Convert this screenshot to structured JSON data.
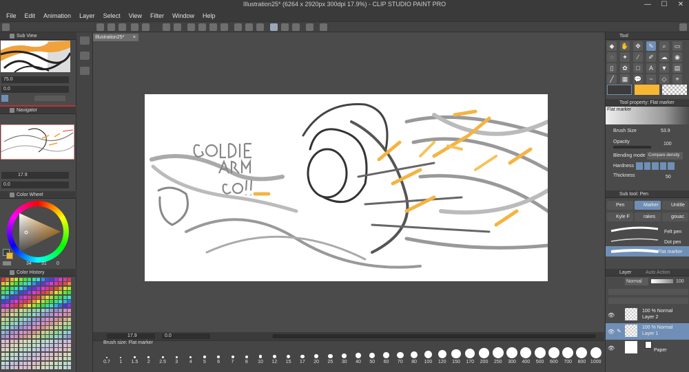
{
  "window": {
    "title": "Illustration25* (6264 x 2920px 300dpi 17.9%) - CLIP STUDIO PAINT PRO",
    "minimize": "—",
    "maximize": "☐",
    "close": "✕"
  },
  "menu": [
    "File",
    "Edit",
    "Animation",
    "Layer",
    "Select",
    "View",
    "Filter",
    "Window",
    "Help"
  ],
  "document_tab": {
    "label": "Illustration25*",
    "close": "×"
  },
  "sub_view": {
    "title": "Sub View",
    "zoom": "75.0",
    "angle": "0.0"
  },
  "navigator": {
    "title": "Navigator",
    "zoom": "17.9",
    "angle": "0.0"
  },
  "color_wheel": {
    "title": "Color Wheel",
    "h": "34",
    "s": "31",
    "v": "0",
    "accent": "#f0a030"
  },
  "color_history": {
    "title": "Color History"
  },
  "canvas_status": {
    "zoom": "17.9",
    "angle": "0.0"
  },
  "brush_size_bar": {
    "title": "Brush size: Flat marker",
    "sizes": [
      "0.7",
      "1",
      "1.5",
      "2",
      "2.5",
      "3",
      "4",
      "5",
      "6",
      "7",
      "8",
      "10",
      "12",
      "15",
      "17",
      "20",
      "25",
      "30",
      "40",
      "50",
      "60",
      "70",
      "80",
      "100",
      "120",
      "150",
      "170",
      "200",
      "250",
      "300",
      "400",
      "500",
      "600",
      "700",
      "800",
      "1000"
    ]
  },
  "tool_panel": {
    "title": "Tool"
  },
  "tool_property": {
    "title": "Tool property: Flat marker",
    "tool_name": "Flat marker",
    "brush_size_label": "Brush Size",
    "brush_size_value": "53.9",
    "opacity_label": "Opacity",
    "opacity_value": "100",
    "blending_label": "Blending mode",
    "blending_value": "Compare density",
    "hardness_label": "Hardness",
    "thickness_label": "Thickness",
    "thickness_value": "50"
  },
  "sub_tool": {
    "title": "Sub tool: Pen",
    "tabs": [
      "Pen",
      "Marker",
      "Untitle",
      "Kyle F",
      "rakes",
      "gouac"
    ],
    "strokes": [
      "Felt pen",
      "Dot pen",
      "Flat marker"
    ]
  },
  "layer_panel": {
    "title": "Layer",
    "auto_action_tab": "Auto Action",
    "blend_mode": "Normal",
    "opacity": "100",
    "layers": [
      {
        "mode": "100 % Normal",
        "name": "Layer 2"
      },
      {
        "mode": "100 % Normal",
        "name": "Layer 1"
      },
      {
        "mode": "",
        "name": "Paper"
      }
    ]
  },
  "colors": {
    "main": "#3b3b3b",
    "sub": "#f7b733",
    "selected": "#6f8fb6"
  },
  "canvas_text": "GOLDIE ARM CO!!"
}
